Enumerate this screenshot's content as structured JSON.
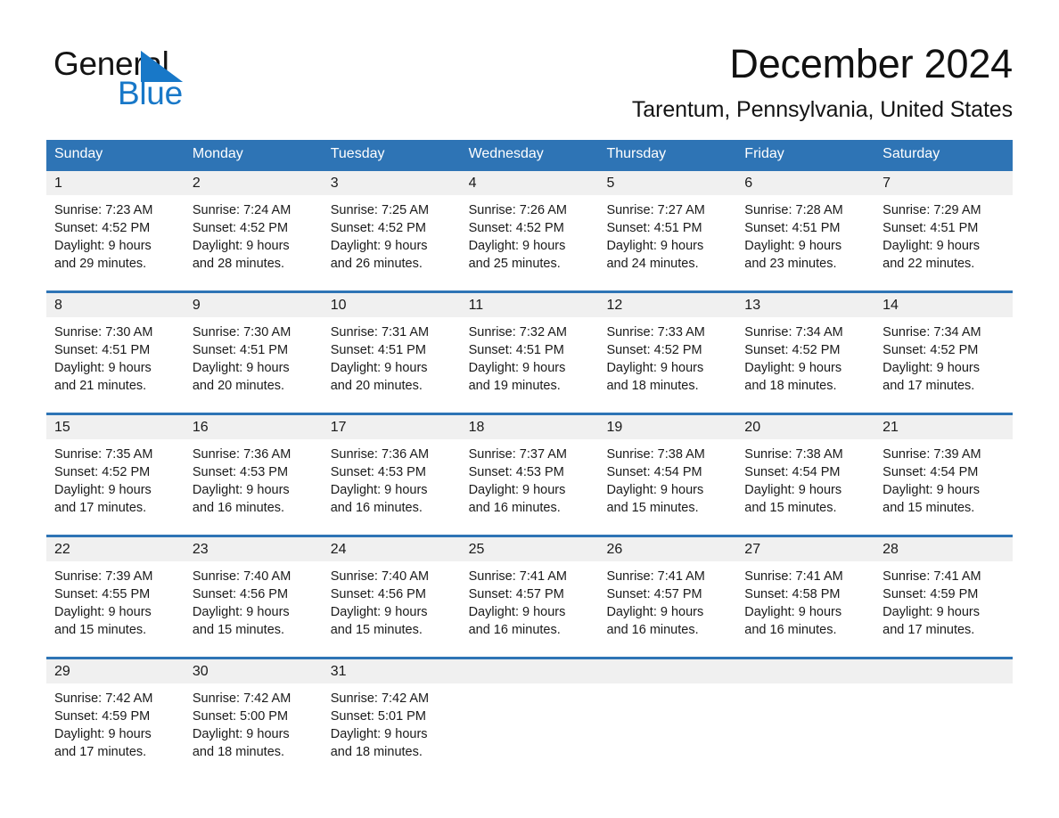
{
  "brand": {
    "name_part1": "General",
    "name_part2": "Blue",
    "triangle_color": "#1878c8"
  },
  "header": {
    "title": "December 2024",
    "subtitle": "Tarentum, Pennsylvania, United States"
  },
  "colors": {
    "header_blue": "#2e74b5",
    "daynum_band": "#f0f0f0",
    "text": "#1a1a1a",
    "brand_blue": "#1878c8"
  },
  "weekday_headers": [
    "Sunday",
    "Monday",
    "Tuesday",
    "Wednesday",
    "Thursday",
    "Friday",
    "Saturday"
  ],
  "weeks": [
    {
      "days": [
        {
          "date": "1",
          "sunrise": "Sunrise: 7:23 AM",
          "sunset": "Sunset: 4:52 PM",
          "daylight1": "Daylight: 9 hours",
          "daylight2": "and 29 minutes."
        },
        {
          "date": "2",
          "sunrise": "Sunrise: 7:24 AM",
          "sunset": "Sunset: 4:52 PM",
          "daylight1": "Daylight: 9 hours",
          "daylight2": "and 28 minutes."
        },
        {
          "date": "3",
          "sunrise": "Sunrise: 7:25 AM",
          "sunset": "Sunset: 4:52 PM",
          "daylight1": "Daylight: 9 hours",
          "daylight2": "and 26 minutes."
        },
        {
          "date": "4",
          "sunrise": "Sunrise: 7:26 AM",
          "sunset": "Sunset: 4:52 PM",
          "daylight1": "Daylight: 9 hours",
          "daylight2": "and 25 minutes."
        },
        {
          "date": "5",
          "sunrise": "Sunrise: 7:27 AM",
          "sunset": "Sunset: 4:51 PM",
          "daylight1": "Daylight: 9 hours",
          "daylight2": "and 24 minutes."
        },
        {
          "date": "6",
          "sunrise": "Sunrise: 7:28 AM",
          "sunset": "Sunset: 4:51 PM",
          "daylight1": "Daylight: 9 hours",
          "daylight2": "and 23 minutes."
        },
        {
          "date": "7",
          "sunrise": "Sunrise: 7:29 AM",
          "sunset": "Sunset: 4:51 PM",
          "daylight1": "Daylight: 9 hours",
          "daylight2": "and 22 minutes."
        }
      ]
    },
    {
      "days": [
        {
          "date": "8",
          "sunrise": "Sunrise: 7:30 AM",
          "sunset": "Sunset: 4:51 PM",
          "daylight1": "Daylight: 9 hours",
          "daylight2": "and 21 minutes."
        },
        {
          "date": "9",
          "sunrise": "Sunrise: 7:30 AM",
          "sunset": "Sunset: 4:51 PM",
          "daylight1": "Daylight: 9 hours",
          "daylight2": "and 20 minutes."
        },
        {
          "date": "10",
          "sunrise": "Sunrise: 7:31 AM",
          "sunset": "Sunset: 4:51 PM",
          "daylight1": "Daylight: 9 hours",
          "daylight2": "and 20 minutes."
        },
        {
          "date": "11",
          "sunrise": "Sunrise: 7:32 AM",
          "sunset": "Sunset: 4:51 PM",
          "daylight1": "Daylight: 9 hours",
          "daylight2": "and 19 minutes."
        },
        {
          "date": "12",
          "sunrise": "Sunrise: 7:33 AM",
          "sunset": "Sunset: 4:52 PM",
          "daylight1": "Daylight: 9 hours",
          "daylight2": "and 18 minutes."
        },
        {
          "date": "13",
          "sunrise": "Sunrise: 7:34 AM",
          "sunset": "Sunset: 4:52 PM",
          "daylight1": "Daylight: 9 hours",
          "daylight2": "and 18 minutes."
        },
        {
          "date": "14",
          "sunrise": "Sunrise: 7:34 AM",
          "sunset": "Sunset: 4:52 PM",
          "daylight1": "Daylight: 9 hours",
          "daylight2": "and 17 minutes."
        }
      ]
    },
    {
      "days": [
        {
          "date": "15",
          "sunrise": "Sunrise: 7:35 AM",
          "sunset": "Sunset: 4:52 PM",
          "daylight1": "Daylight: 9 hours",
          "daylight2": "and 17 minutes."
        },
        {
          "date": "16",
          "sunrise": "Sunrise: 7:36 AM",
          "sunset": "Sunset: 4:53 PM",
          "daylight1": "Daylight: 9 hours",
          "daylight2": "and 16 minutes."
        },
        {
          "date": "17",
          "sunrise": "Sunrise: 7:36 AM",
          "sunset": "Sunset: 4:53 PM",
          "daylight1": "Daylight: 9 hours",
          "daylight2": "and 16 minutes."
        },
        {
          "date": "18",
          "sunrise": "Sunrise: 7:37 AM",
          "sunset": "Sunset: 4:53 PM",
          "daylight1": "Daylight: 9 hours",
          "daylight2": "and 16 minutes."
        },
        {
          "date": "19",
          "sunrise": "Sunrise: 7:38 AM",
          "sunset": "Sunset: 4:54 PM",
          "daylight1": "Daylight: 9 hours",
          "daylight2": "and 15 minutes."
        },
        {
          "date": "20",
          "sunrise": "Sunrise: 7:38 AM",
          "sunset": "Sunset: 4:54 PM",
          "daylight1": "Daylight: 9 hours",
          "daylight2": "and 15 minutes."
        },
        {
          "date": "21",
          "sunrise": "Sunrise: 7:39 AM",
          "sunset": "Sunset: 4:54 PM",
          "daylight1": "Daylight: 9 hours",
          "daylight2": "and 15 minutes."
        }
      ]
    },
    {
      "days": [
        {
          "date": "22",
          "sunrise": "Sunrise: 7:39 AM",
          "sunset": "Sunset: 4:55 PM",
          "daylight1": "Daylight: 9 hours",
          "daylight2": "and 15 minutes."
        },
        {
          "date": "23",
          "sunrise": "Sunrise: 7:40 AM",
          "sunset": "Sunset: 4:56 PM",
          "daylight1": "Daylight: 9 hours",
          "daylight2": "and 15 minutes."
        },
        {
          "date": "24",
          "sunrise": "Sunrise: 7:40 AM",
          "sunset": "Sunset: 4:56 PM",
          "daylight1": "Daylight: 9 hours",
          "daylight2": "and 15 minutes."
        },
        {
          "date": "25",
          "sunrise": "Sunrise: 7:41 AM",
          "sunset": "Sunset: 4:57 PM",
          "daylight1": "Daylight: 9 hours",
          "daylight2": "and 16 minutes."
        },
        {
          "date": "26",
          "sunrise": "Sunrise: 7:41 AM",
          "sunset": "Sunset: 4:57 PM",
          "daylight1": "Daylight: 9 hours",
          "daylight2": "and 16 minutes."
        },
        {
          "date": "27",
          "sunrise": "Sunrise: 7:41 AM",
          "sunset": "Sunset: 4:58 PM",
          "daylight1": "Daylight: 9 hours",
          "daylight2": "and 16 minutes."
        },
        {
          "date": "28",
          "sunrise": "Sunrise: 7:41 AM",
          "sunset": "Sunset: 4:59 PM",
          "daylight1": "Daylight: 9 hours",
          "daylight2": "and 17 minutes."
        }
      ]
    },
    {
      "days": [
        {
          "date": "29",
          "sunrise": "Sunrise: 7:42 AM",
          "sunset": "Sunset: 4:59 PM",
          "daylight1": "Daylight: 9 hours",
          "daylight2": "and 17 minutes."
        },
        {
          "date": "30",
          "sunrise": "Sunrise: 7:42 AM",
          "sunset": "Sunset: 5:00 PM",
          "daylight1": "Daylight: 9 hours",
          "daylight2": "and 18 minutes."
        },
        {
          "date": "31",
          "sunrise": "Sunrise: 7:42 AM",
          "sunset": "Sunset: 5:01 PM",
          "daylight1": "Daylight: 9 hours",
          "daylight2": "and 18 minutes."
        },
        {
          "date": "",
          "sunrise": "",
          "sunset": "",
          "daylight1": "",
          "daylight2": ""
        },
        {
          "date": "",
          "sunrise": "",
          "sunset": "",
          "daylight1": "",
          "daylight2": ""
        },
        {
          "date": "",
          "sunrise": "",
          "sunset": "",
          "daylight1": "",
          "daylight2": ""
        },
        {
          "date": "",
          "sunrise": "",
          "sunset": "",
          "daylight1": "",
          "daylight2": ""
        }
      ]
    }
  ]
}
